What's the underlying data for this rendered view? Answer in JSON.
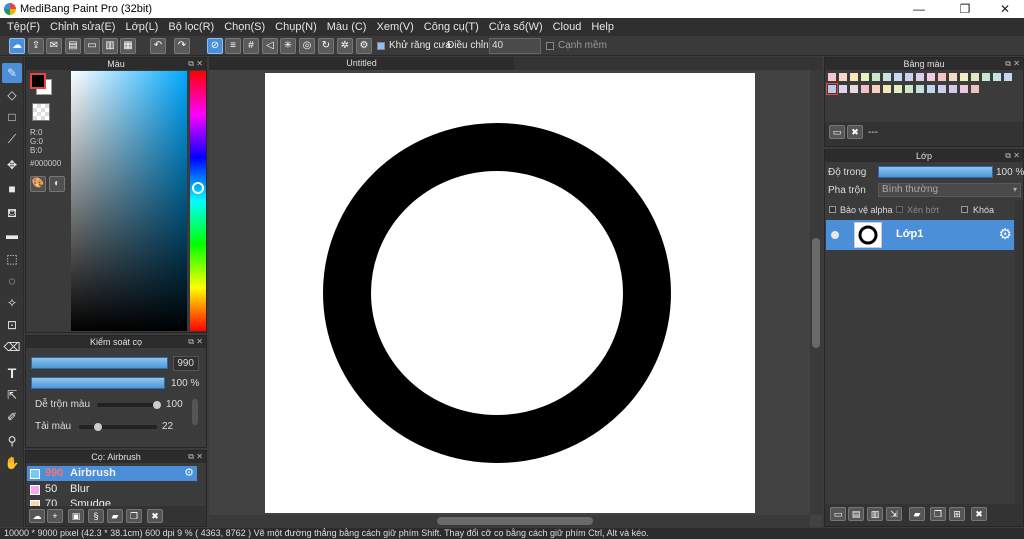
{
  "window": {
    "title": "MediBang Paint Pro (32bit)",
    "minimize": "—",
    "restore": "❐",
    "close": "✕"
  },
  "menus": [
    "Tệp(F)",
    "Chỉnh sửa(E)",
    "Lớp(L)",
    "Bộ lọc(R)",
    "Chọn(S)",
    "Chụp(N)",
    "Màu (C)",
    "Xem(V)",
    "Công cụ(T)",
    "Cửa sổ(W)",
    "Cloud",
    "Help"
  ],
  "toolbar": {
    "antialias_label": "Khử răng cưa",
    "adjust_label": "Điều chỉnh",
    "adjust_value": "40",
    "smooth_edge_label": "Cạnh mềm"
  },
  "color_panel": {
    "title": "Màu",
    "r": "R:0",
    "g": "G:0",
    "b": "B:0",
    "hex": "#000000",
    "accent": "#00a8ff"
  },
  "brush_control": {
    "title": "Kiểm soát cọ",
    "size_value": "990",
    "opacity_value": "100 %",
    "blend_label": "Dễ trộn màu",
    "blend_value": "100",
    "load_label": "Tải màu",
    "load_value": "22"
  },
  "brush_list": {
    "title": "Cọ: Airbrush",
    "items": [
      {
        "size": "990",
        "name": "Airbrush",
        "color": "#7ec8f0"
      },
      {
        "size": "50",
        "name": "Blur",
        "color": "#f4a8f0"
      },
      {
        "size": "70",
        "name": "Smudge",
        "color": "#f8d8b0"
      }
    ]
  },
  "document": {
    "tab_title": "Untitled"
  },
  "palette_panel": {
    "title": "Bảng màu",
    "footer_text": "---"
  },
  "layer_panel": {
    "title": "Lớp",
    "opacity_label": "Độ trong",
    "opacity_value": "100 %",
    "blend_label": "Pha trộn",
    "blend_value": "Bình thường",
    "protect_alpha_label": "Bảo vệ alpha",
    "clipping_label": "Xén bớt",
    "lock_label": "Khóa",
    "layer_name": "Lớp1"
  },
  "statusbar": {
    "text": "10000 * 9000 pixel   (42.3 * 38.1cm)   600 dpi   9 %   ( 4363, 8762 )   Vẽ một đường thẳng bằng cách giữ phím Shift. Thay đổi cỡ cọ bằng cách giữ phím Ctrl, Alt và kéo."
  }
}
